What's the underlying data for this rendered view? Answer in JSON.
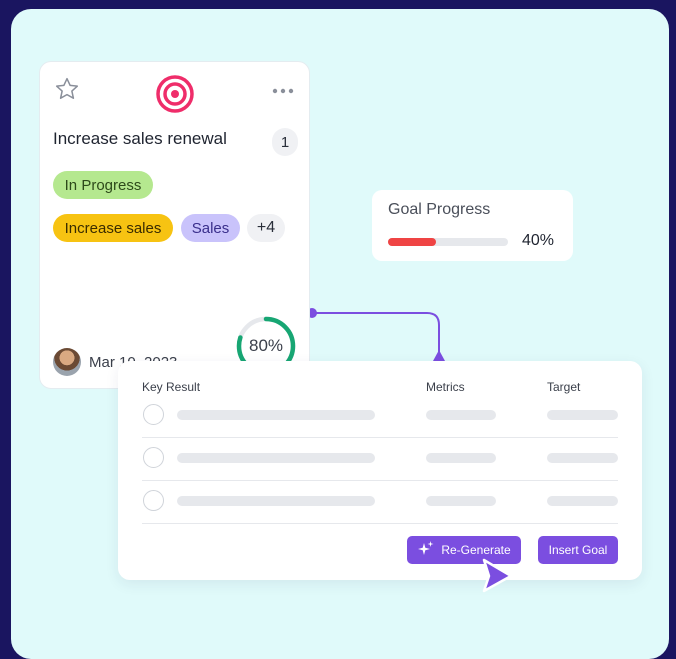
{
  "goal_card": {
    "title": "Increase sales renewal",
    "count": "1",
    "status": "In Progress",
    "tags": [
      "Increase sales",
      "Sales"
    ],
    "more_tags": "+4",
    "date": "Mar 10, 2023",
    "completion": "80%",
    "completion_value": 80,
    "colors": {
      "target_icon": "#ef2d6a",
      "ring": "#17a673",
      "status": "#b5e88f"
    }
  },
  "goal_progress": {
    "title": "Goal Progress",
    "value_label": "40%",
    "value": 40,
    "bar_color": "#ef4444"
  },
  "key_results": {
    "headers": {
      "key_result": "Key Result",
      "metrics": "Metrics",
      "target": "Target"
    },
    "rows": [
      {
        "loading": true
      },
      {
        "loading": true
      },
      {
        "loading": true
      }
    ],
    "regenerate_label": "Re-Generate",
    "insert_label": "Insert Goal",
    "accent": "#7b4ee0"
  },
  "icons": [
    "star-icon",
    "target-icon",
    "more-icon",
    "sparkle-icon",
    "cursor-icon"
  ]
}
